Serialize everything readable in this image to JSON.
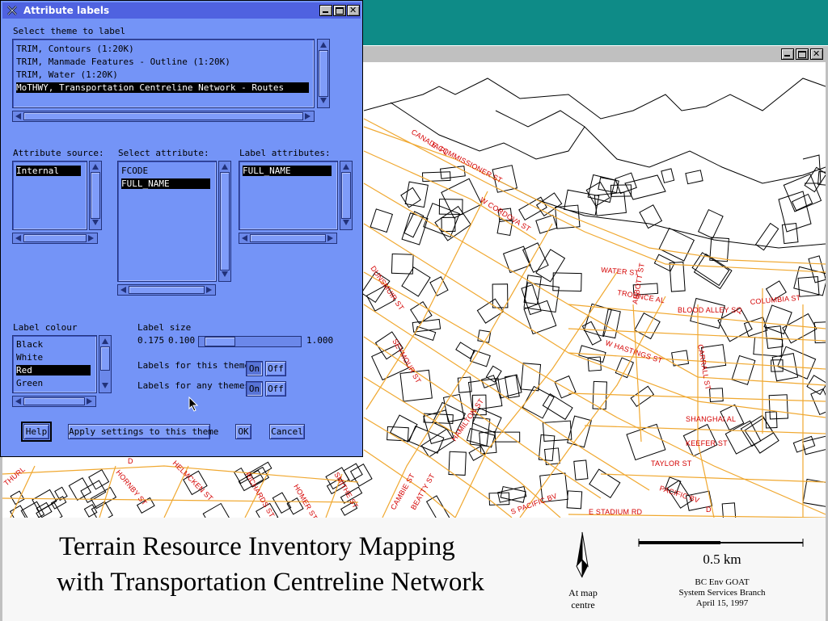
{
  "dialog": {
    "title": "Attribute labels",
    "theme_label": "Select theme to label",
    "themes": [
      "TRIM, Contours (1:20K)",
      "TRIM, Manmade Features - Outline (1:20K)",
      "TRIM, Water (1:20K)",
      "MoTHWY, Transportation Centreline Network - Routes"
    ],
    "selected_theme": 3,
    "attribute_source_label": "Attribute source:",
    "attribute_sources": [
      "Internal"
    ],
    "select_attribute_label": "Select attribute:",
    "attributes": [
      "FCODE",
      "FULL_NAME"
    ],
    "label_attributes_label": "Label attributes:",
    "label_attributes": [
      "FULL_NAME"
    ],
    "label_colour_label": "Label colour",
    "colours": [
      "Black",
      "White",
      "Red",
      "Green"
    ],
    "selected_colour": 2,
    "label_size_label": "Label size",
    "size_current": "0.175",
    "size_min": "0.100",
    "size_max": "1.000",
    "size_fraction": 0.08,
    "labels_this_theme": "Labels for this theme",
    "labels_any_themes": "Labels for any themes",
    "on": "On",
    "off": "Off",
    "buttons": {
      "help": "Help",
      "apply": "Apply settings to this theme",
      "ok": "OK",
      "cancel": "Cancel"
    }
  },
  "map": {
    "streets": [
      "CANADA PL",
      "E COMMISSIONER ST",
      "W CORDOVA ST",
      "DUNSMUIR ST",
      "SEYMOUR ST",
      "HAMILTON ST",
      "WATER ST",
      "TROUNCE AL",
      "BLOOD ALLEY SQ",
      "COLUMBIA ST",
      "ABBOTT ST",
      "W HASTINGS ST",
      "CARRALL ST",
      "SHANGHAI AL",
      "KEEFER ST",
      "TAYLOR ST",
      "PACIFIC BV",
      "E STADIUM RD",
      "D",
      "S PACIFIC BV",
      "BEATTY ST",
      "CAMBIE ST",
      "SMITHE ST",
      "HOMER ST",
      "RICHARDS ST",
      "HELMCKEN ST",
      "HORNBY ST",
      "THURL",
      "D"
    ],
    "title_line1": "Terrain Resource Inventory Mapping",
    "title_line2": "with Transportation Centreline Network",
    "north_caption_1": "At map",
    "north_caption_2": "centre",
    "scale_label": "0.5 km",
    "credit_1": "BC Env GOAT",
    "credit_2": "System Services Branch",
    "credit_3": "April 15, 1997"
  },
  "colors": {
    "desktop": "#0e8b87",
    "dialog": "#7494f7",
    "road": "#f0a830",
    "label": "#d40000"
  }
}
